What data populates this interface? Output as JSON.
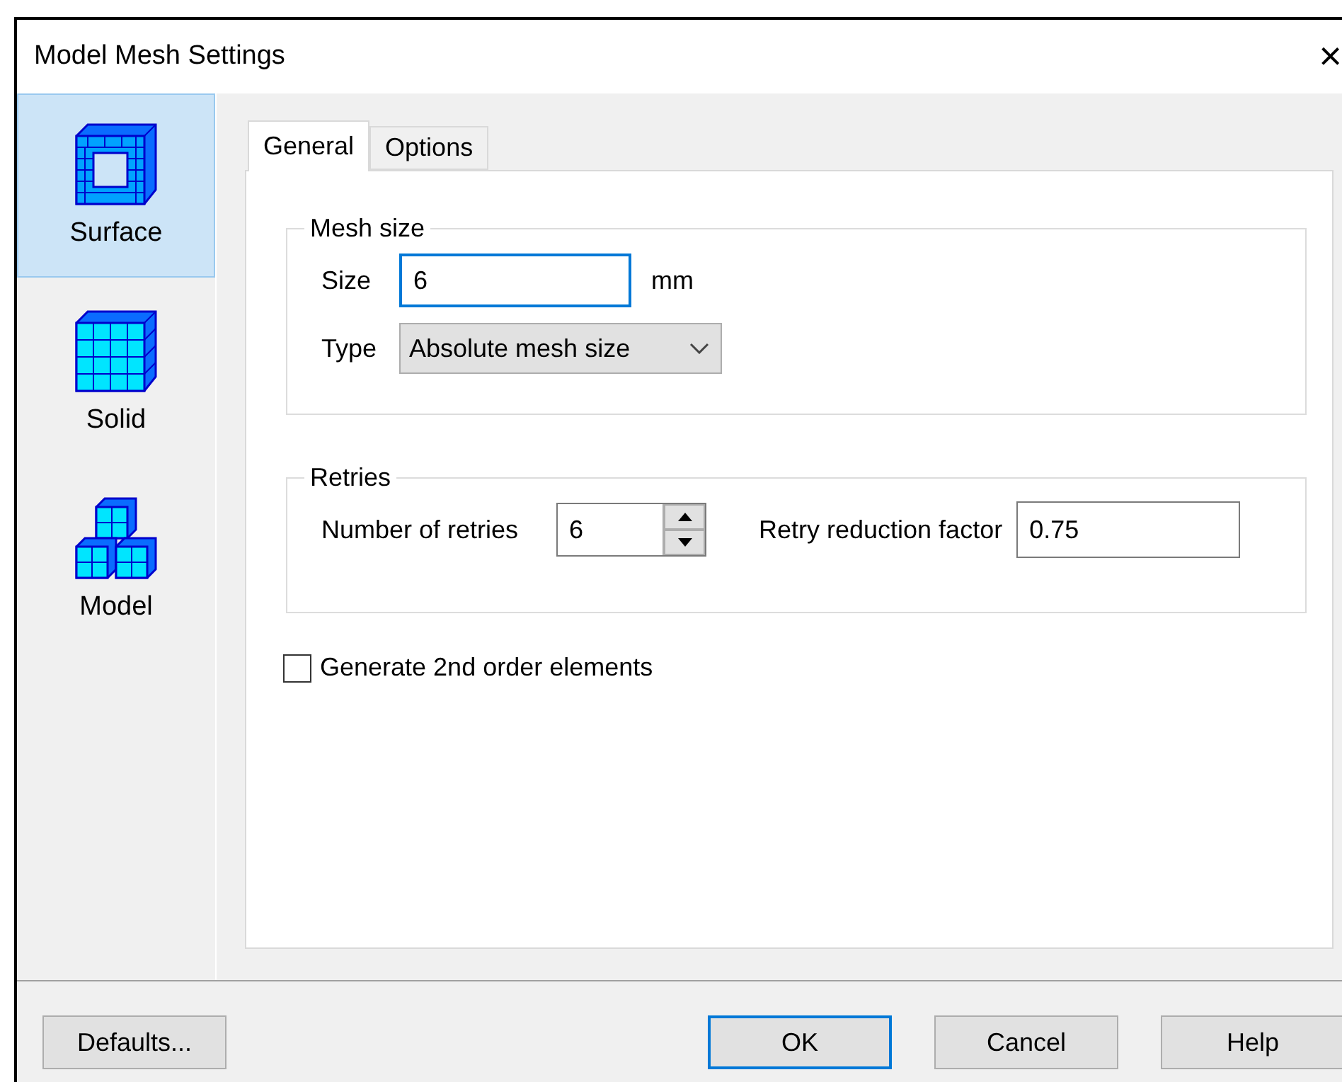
{
  "window": {
    "title": "Model Mesh Settings",
    "close": "×"
  },
  "sidebar": {
    "items": [
      {
        "label": "Surface",
        "kind": "surface",
        "selected": true
      },
      {
        "label": "Solid",
        "kind": "solid",
        "selected": false
      },
      {
        "label": "Model",
        "kind": "model",
        "selected": false
      }
    ]
  },
  "tabs": [
    {
      "label": "General",
      "selected": true
    },
    {
      "label": "Options",
      "selected": false
    }
  ],
  "mesh_size": {
    "title": "Mesh size",
    "size": {
      "label": "Size",
      "value": "6",
      "focused": true,
      "unit": "mm"
    },
    "type": {
      "label": "Type",
      "value": "Absolute mesh size"
    }
  },
  "retries": {
    "title": "Retries",
    "number": {
      "label": "Number of retries",
      "value": "6"
    },
    "factor": {
      "label": "Retry reduction factor",
      "value": "0.75"
    }
  },
  "second_order": {
    "label": "Generate 2nd order elements",
    "checked": false
  },
  "left_buttons": [
    {
      "label": "Defaults...",
      "default": false
    }
  ],
  "right_buttons": [
    {
      "label": "OK",
      "default": true
    },
    {
      "label": "Cancel",
      "default": false
    },
    {
      "label": "Help",
      "default": false
    }
  ]
}
